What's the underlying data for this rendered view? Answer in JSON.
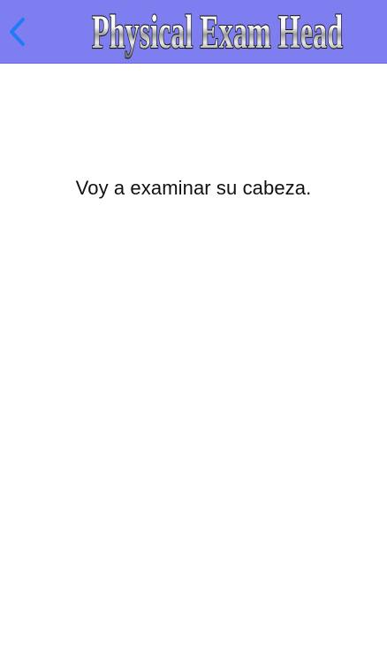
{
  "navbar": {
    "title": "Physical Exam Head",
    "back_icon": "chevron-left-icon",
    "background_color": "#7e7ef0",
    "back_icon_color": "#1e7cf5"
  },
  "main": {
    "phrase": "Voy a examinar su cabeza."
  }
}
